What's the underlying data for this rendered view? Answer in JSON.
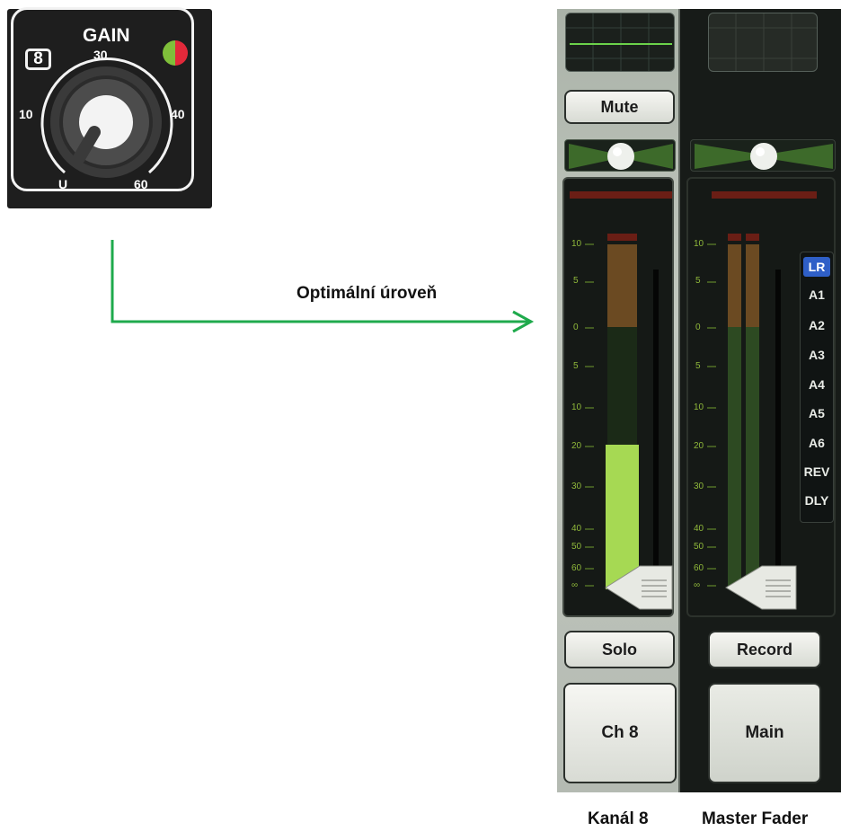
{
  "gain_panel": {
    "title": "GAIN",
    "channel_number": "8",
    "scale": {
      "s30": "30",
      "s10": "10",
      "s40": "40",
      "sU": "U",
      "s60": "60"
    }
  },
  "annotation": {
    "optimal_level": "Optimální úroveň"
  },
  "channel_strip": {
    "mute_label": "Mute",
    "solo_label": "Solo",
    "name_label": "Ch 8",
    "meter_level": 0.55,
    "scale": {
      "t10": "10",
      "t5": "5",
      "t0": "0",
      "t5b": "5",
      "t10b": "10",
      "t20": "20",
      "t30": "30",
      "t40": "40",
      "t50": "50",
      "t60": "60",
      "tinf": "∞"
    }
  },
  "master_strip": {
    "record_label": "Record",
    "name_label": "Main",
    "scale": {
      "t10": "10",
      "t5": "5",
      "t0": "0",
      "t5b": "5",
      "t10b": "10",
      "t20": "20",
      "t30": "30",
      "t40": "40",
      "t50": "50",
      "t60": "60",
      "tinf": "∞"
    },
    "buses": [
      "LR",
      "A1",
      "A2",
      "A3",
      "A4",
      "A5",
      "A6",
      "REV",
      "DLY"
    ],
    "selected_bus": "LR"
  },
  "captions": {
    "channel": "Kanál 8",
    "master": "Master Fader"
  },
  "colors": {
    "meter_green": "#a6d953",
    "arrow_green": "#1faa4c",
    "selected_bus": "#2f5fc7"
  }
}
